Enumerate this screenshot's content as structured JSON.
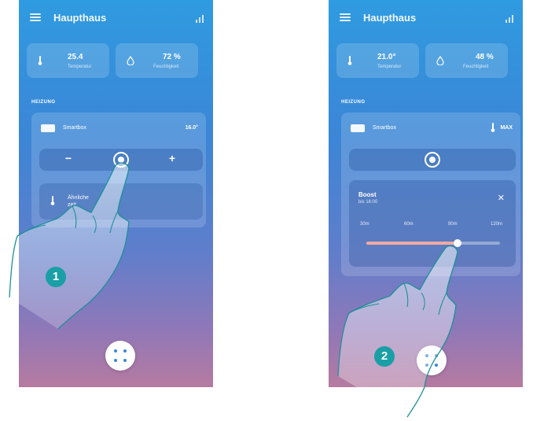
{
  "colors": {
    "accent": "#1a9fa6",
    "slider_fill": "#f2a9a2",
    "background_top": "#2f9be0",
    "background_bottom": "#b67aa0"
  },
  "left": {
    "header": {
      "title": "Haupthaus"
    },
    "tiles": [
      {
        "value": "25.4",
        "label": "Temperatur"
      },
      {
        "value": "72 %",
        "label": "Feuchtigkeit"
      }
    ],
    "section_label": "HEIZUNG",
    "zone": {
      "name": "Smartbox",
      "temperature": "16.0°"
    },
    "controls": {
      "minus": "−",
      "plus": "+"
    },
    "status": {
      "line1": "Ähnliche",
      "line2": "zeit"
    }
  },
  "right": {
    "header": {
      "title": "Haupthaus"
    },
    "tiles": [
      {
        "value": "21.0°",
        "label": "Temperatur"
      },
      {
        "value": "48 %",
        "label": "Feuchtigkeit"
      }
    ],
    "section_label": "HEIZUNG",
    "zone": {
      "name": "Smartbox",
      "mode": "MAX"
    },
    "boost": {
      "title": "Boost",
      "subtitle": "bis 16:00",
      "close": "✕"
    },
    "slider": {
      "ticks": [
        "30m",
        "60m",
        "90m",
        "120m"
      ],
      "value_fraction": 0.68
    }
  },
  "steps": [
    "1",
    "2"
  ]
}
